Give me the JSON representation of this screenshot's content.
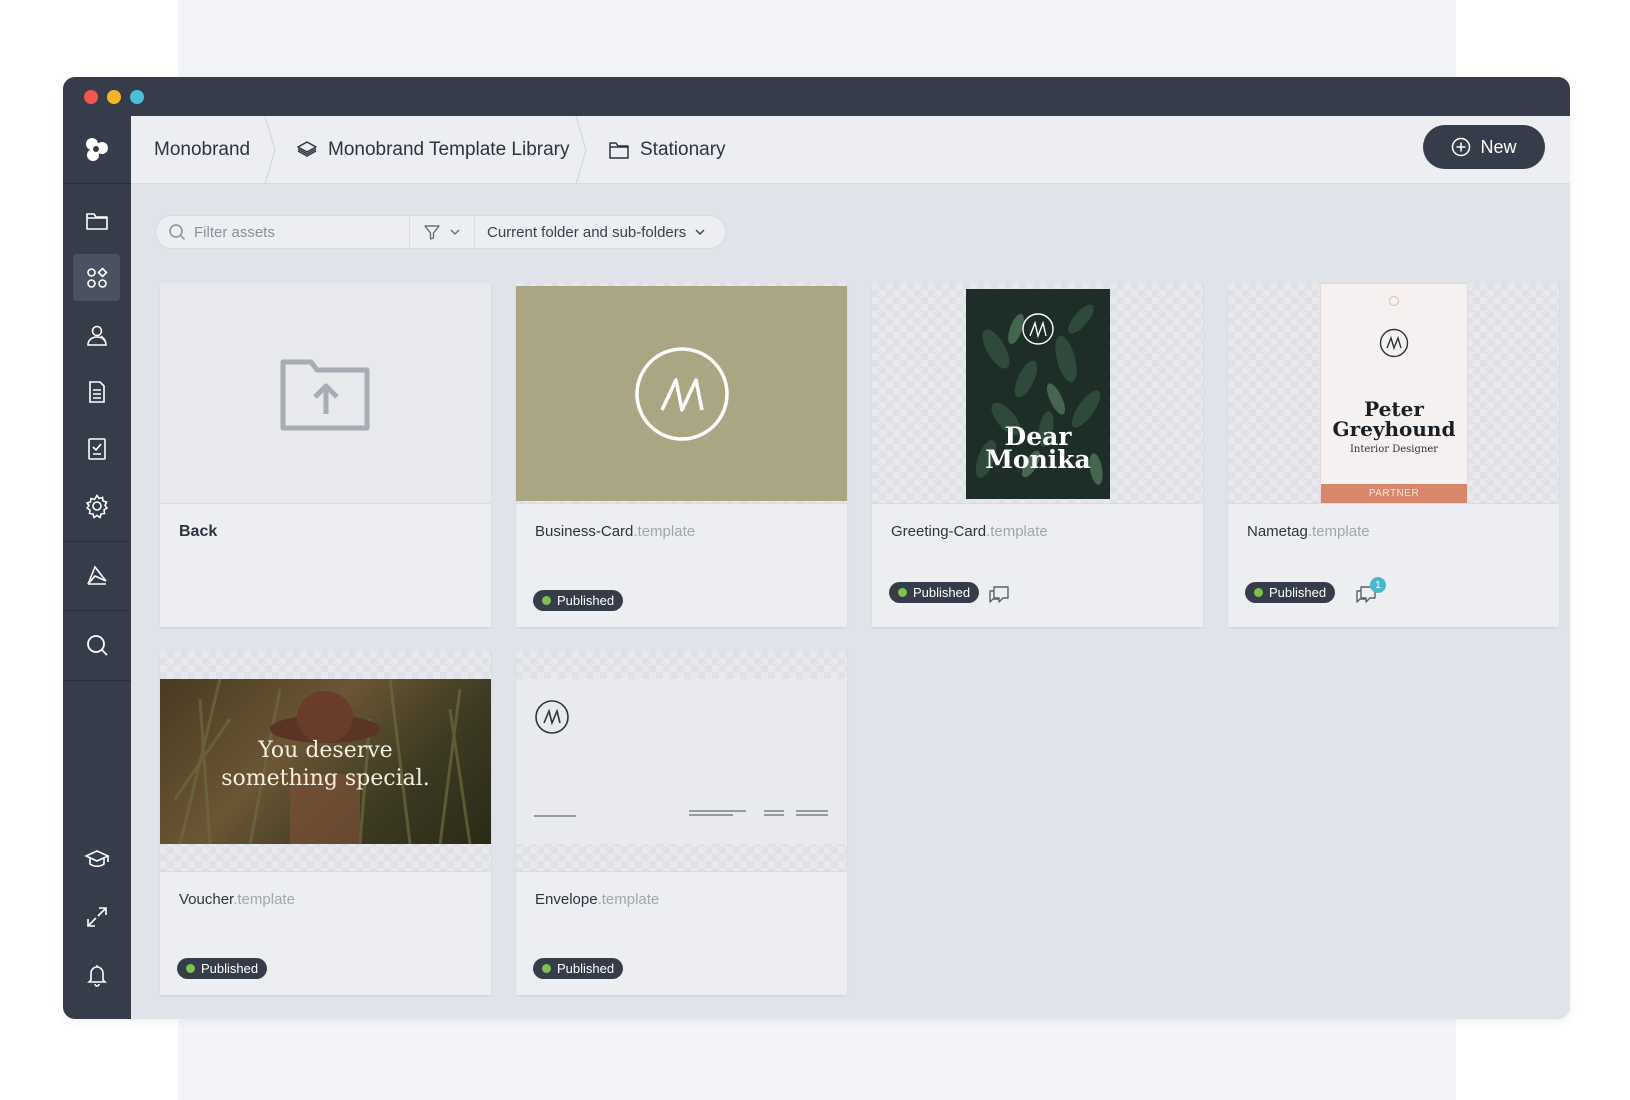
{
  "window": {
    "traffic_lights": [
      "close",
      "minimize",
      "maximize"
    ]
  },
  "sidebar": {
    "logo_icon": "brand-logo-icon",
    "items": [
      {
        "icon": "folder-icon",
        "active": false
      },
      {
        "icon": "apps-grid-icon",
        "active": true
      },
      {
        "icon": "users-icon",
        "active": false
      },
      {
        "icon": "document-list-icon",
        "active": false
      },
      {
        "icon": "checklist-icon",
        "active": false
      },
      {
        "icon": "gear-icon",
        "active": false
      },
      {
        "icon": "analytics-icon",
        "active": false
      },
      {
        "icon": "search-icon",
        "active": false
      },
      {
        "icon": "graduation-cap-icon",
        "active": false
      },
      {
        "icon": "expand-icon",
        "active": false
      },
      {
        "icon": "bell-icon",
        "active": false
      }
    ]
  },
  "breadcrumb": {
    "items": [
      {
        "label": "Monobrand",
        "icon": ""
      },
      {
        "label": "Monobrand Template Library",
        "icon": "layers-icon"
      },
      {
        "label": "Stationary",
        "icon": "folder-icon"
      }
    ]
  },
  "toolbar": {
    "new_label": "New"
  },
  "filter": {
    "placeholder": "Filter assets",
    "scope_label": "Current folder and sub-folders"
  },
  "cards": [
    {
      "name": "Back",
      "ext": "",
      "status": ""
    },
    {
      "name": "Business-Card",
      "ext": ".template",
      "status": "Published"
    },
    {
      "name": "Greeting-Card",
      "ext": ".template",
      "status": "Published",
      "comments": ""
    },
    {
      "name": "Nametag",
      "ext": ".template",
      "status": "Published",
      "comments": "1"
    },
    {
      "name": "Voucher",
      "ext": ".template",
      "status": "Published"
    },
    {
      "name": "Envelope",
      "ext": ".template",
      "status": "Published"
    }
  ],
  "thumbs": {
    "greeting": {
      "line1": "Dear",
      "line2": "Monika"
    },
    "nametag": {
      "name1": "Peter",
      "name2": "Greyhound",
      "role": "Interior Designer",
      "tag": "PARTNER"
    },
    "voucher": {
      "line1": "You deserve",
      "line2": "something special."
    }
  },
  "colors": {
    "dark": "#363d4a",
    "business_card_bg": "#aaa583",
    "published_dot": "#7bc24f",
    "comment_badge": "#48b8cf",
    "partner_bar": "#d7876a"
  }
}
